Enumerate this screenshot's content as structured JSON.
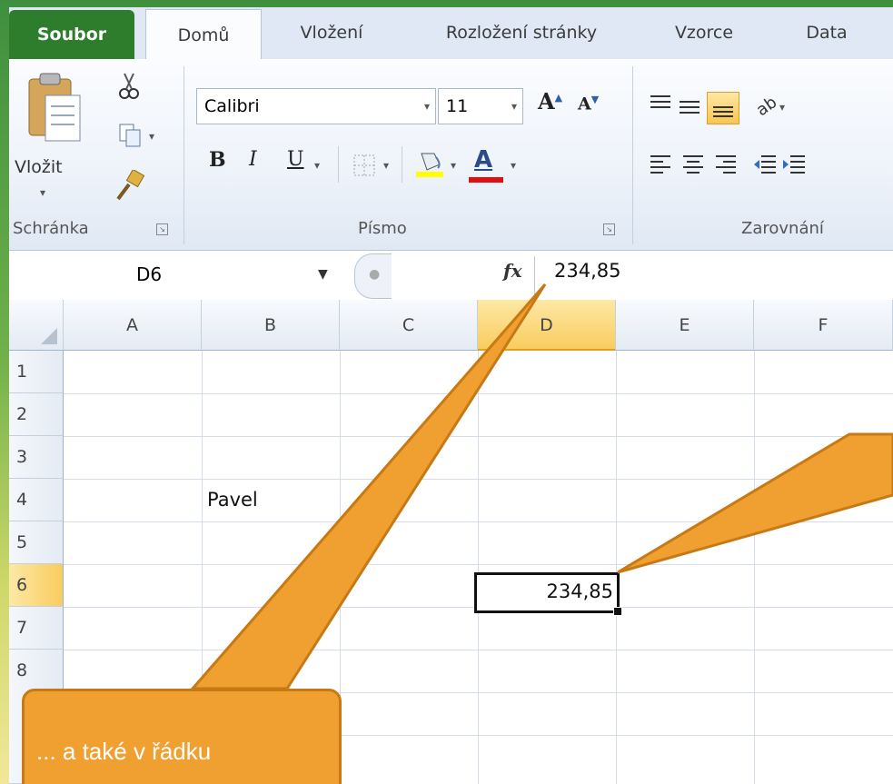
{
  "tabs": [
    {
      "label": "Soubor",
      "kind": "file"
    },
    {
      "label": "Domů",
      "kind": "active"
    },
    {
      "label": "Vložení",
      "kind": "normal"
    },
    {
      "label": "Rozložení stránky",
      "kind": "normal"
    },
    {
      "label": "Vzorce",
      "kind": "normal"
    },
    {
      "label": "Data",
      "kind": "normal"
    }
  ],
  "ribbon": {
    "paste_label": "Vložit",
    "font_name": "Calibri",
    "font_size": "11",
    "groups": {
      "clipboard": "Schránka",
      "font": "Písmo",
      "alignment": "Zarovnání"
    },
    "bold_label": "B",
    "italic_label": "I",
    "underline_label": "U",
    "font_color_label": "A"
  },
  "formula_bar": {
    "name_box": "D6",
    "fx_label": "fx",
    "value": "234,85"
  },
  "sheet": {
    "columns": [
      "A",
      "B",
      "C",
      "D",
      "E",
      "F"
    ],
    "rows": [
      "1",
      "2",
      "3",
      "4",
      "5",
      "6",
      "7",
      "8"
    ],
    "selected_column": "D",
    "selected_row": "6",
    "cells": {
      "B4": "Pavel",
      "D6": "234,85"
    }
  },
  "callout": {
    "text": "... a také v řádku"
  },
  "colors": {
    "file_tab": "#2d7d2d",
    "selection": "#f9cc5f",
    "callout": "#f0a030"
  }
}
